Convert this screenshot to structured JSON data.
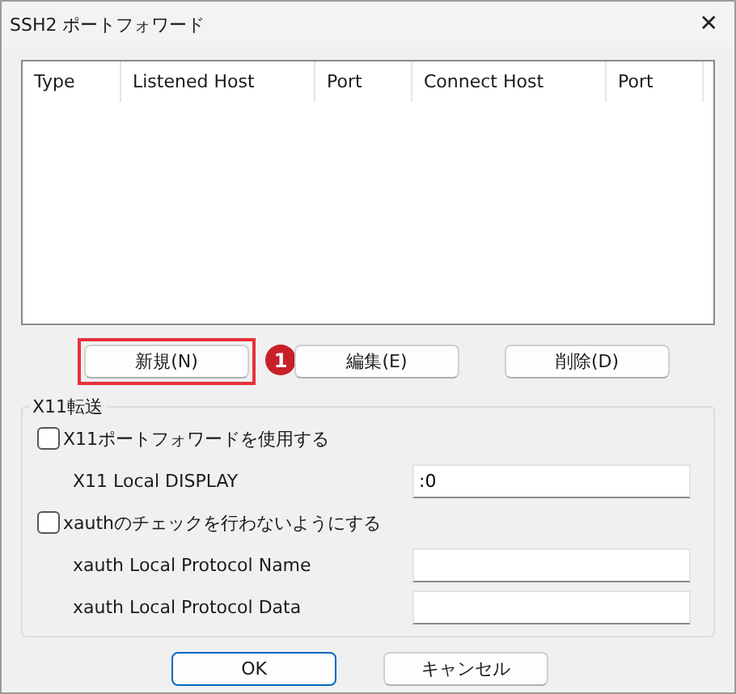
{
  "window": {
    "title": "SSH2 ポートフォワード",
    "close_glyph": "✕"
  },
  "list": {
    "columns": [
      "Type",
      "Listened Host",
      "Port",
      "Connect Host",
      "Port"
    ]
  },
  "list_buttons": [
    {
      "label": "新規(N)",
      "highlighted": true,
      "marker": "1"
    },
    {
      "label": "編集(E)",
      "highlighted": false
    },
    {
      "label": "削除(D)",
      "highlighted": false
    }
  ],
  "x11_group": {
    "title": "X11転送",
    "rows": [
      {
        "kind": "checkbox",
        "label": "X11ポートフォワードを使用する",
        "checked": false
      },
      {
        "kind": "field",
        "label": "X11 Local DISPLAY",
        "value": ":0"
      },
      {
        "kind": "checkbox",
        "label": "xauthのチェックを行わないようにする",
        "checked": false
      },
      {
        "kind": "field",
        "label": "xauth Local Protocol Name"
      },
      {
        "kind": "field",
        "label": "xauth Local Protocol Data"
      }
    ]
  },
  "buttons": [
    {
      "label": "OK",
      "default": true
    },
    {
      "label": "キャンセル",
      "default": false
    }
  ]
}
